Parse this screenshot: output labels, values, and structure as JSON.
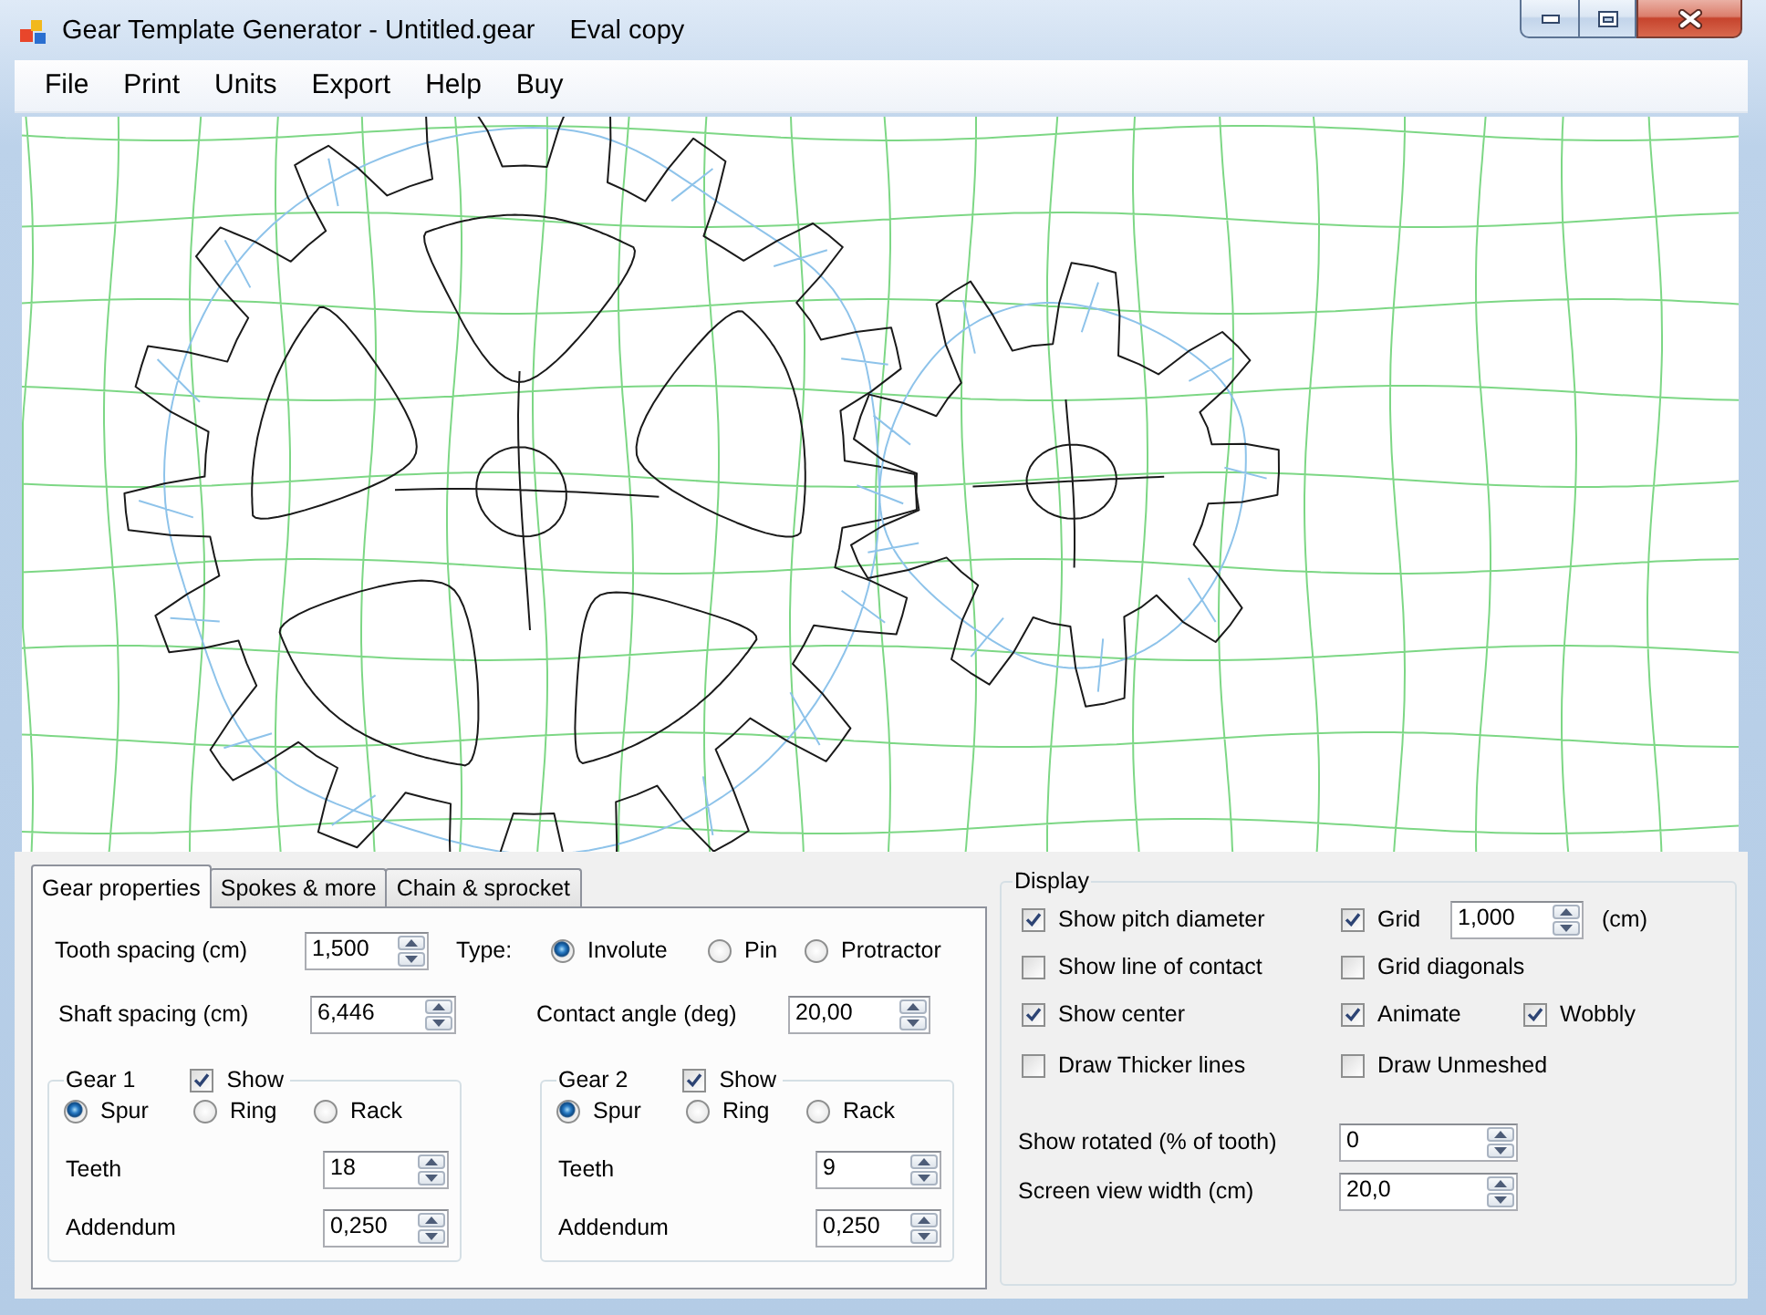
{
  "window": {
    "title": "Gear Template Generator - Untitled.gear",
    "edition": "Eval copy"
  },
  "menu": [
    "File",
    "Print",
    "Units",
    "Export",
    "Help",
    "Buy"
  ],
  "tabs": [
    {
      "label": "Gear properties",
      "selected": true
    },
    {
      "label": "Spokes & more",
      "selected": false
    },
    {
      "label": "Chain & sprocket",
      "selected": false
    }
  ],
  "gear_properties": {
    "tooth_spacing": {
      "label": "Tooth spacing (cm)",
      "value": "1,500"
    },
    "type": {
      "label": "Type:",
      "options": [
        {
          "label": "Involute",
          "selected": true
        },
        {
          "label": "Pin",
          "selected": false
        },
        {
          "label": "Protractor",
          "selected": false
        }
      ]
    },
    "shaft_spacing": {
      "label": "Shaft spacing (cm)",
      "value": "6,446"
    },
    "contact_angle": {
      "label": "Contact angle (deg)",
      "value": "20,00"
    },
    "gears": [
      {
        "title": "Gear 1",
        "show": {
          "label": "Show",
          "checked": true
        },
        "kinds": [
          {
            "label": "Spur",
            "selected": true
          },
          {
            "label": "Ring",
            "selected": false
          },
          {
            "label": "Rack",
            "selected": false
          }
        ],
        "teeth": {
          "label": "Teeth",
          "value": "18"
        },
        "addendum": {
          "label": "Addendum",
          "value": "0,250"
        }
      },
      {
        "title": "Gear 2",
        "show": {
          "label": "Show",
          "checked": true
        },
        "kinds": [
          {
            "label": "Spur",
            "selected": true
          },
          {
            "label": "Ring",
            "selected": false
          },
          {
            "label": "Rack",
            "selected": false
          }
        ],
        "teeth": {
          "label": "Teeth",
          "value": "9"
        },
        "addendum": {
          "label": "Addendum",
          "value": "0,250"
        }
      }
    ]
  },
  "display": {
    "title": "Display",
    "pitch_diameter": {
      "label": "Show pitch diameter",
      "checked": true
    },
    "grid": {
      "label": "Grid",
      "checked": true,
      "value": "1,000",
      "unit": "(cm)"
    },
    "line_of_contact": {
      "label": "Show line of contact",
      "checked": false
    },
    "grid_diagonals": {
      "label": "Grid diagonals",
      "checked": false
    },
    "center": {
      "label": "Show center",
      "checked": true
    },
    "animate": {
      "label": "Animate",
      "checked": true
    },
    "wobbly": {
      "label": "Wobbly",
      "checked": true
    },
    "thicker_lines": {
      "label": "Draw Thicker lines",
      "checked": false
    },
    "unmeshed": {
      "label": "Draw Unmeshed",
      "checked": false
    },
    "rotated": {
      "label": "Show rotated (% of tooth)",
      "value": "0"
    },
    "view_width": {
      "label": "Screen view width (cm)",
      "value": "20,0"
    }
  }
}
